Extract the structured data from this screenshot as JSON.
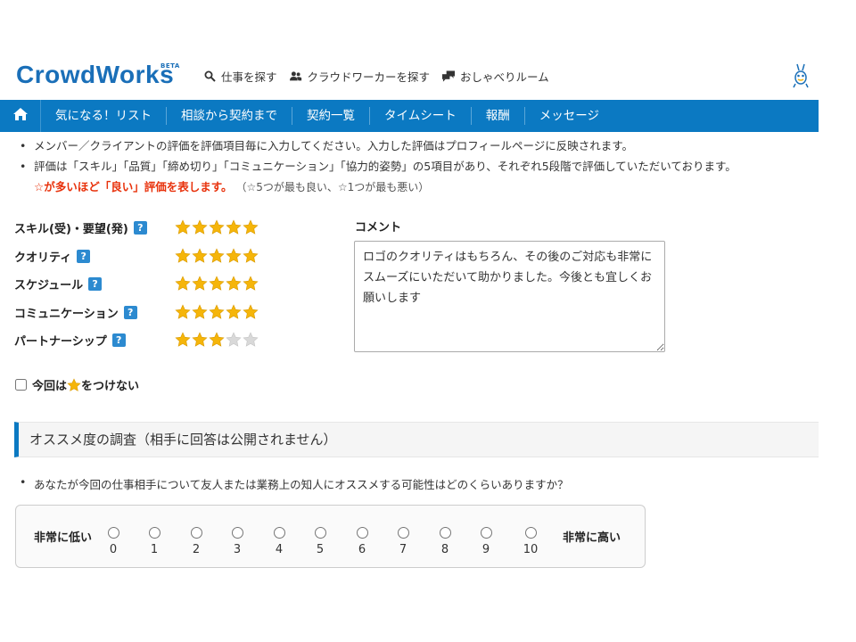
{
  "header": {
    "logo": "CrowdWorks",
    "logo_badge": "BETA",
    "links": [
      {
        "label": "仕事を探す",
        "icon": "search-icon"
      },
      {
        "label": "クラウドワーカーを探す",
        "icon": "users-icon"
      },
      {
        "label": "おしゃべりルーム",
        "icon": "chat-icon"
      }
    ]
  },
  "nav": {
    "home_icon": "home-icon",
    "items": [
      "気になる！リスト",
      "相談から契約まで",
      "契約一覧",
      "タイムシート",
      "報酬",
      "メッセージ"
    ]
  },
  "notes": {
    "line1": "メンバー／クライアントの評価を評価項目毎に入力してください。入力した評価はプロフィールページに反映されます。",
    "line2": "評価は「スキル」「品質」「締め切り」「コミュニケーション」「協力的姿勢」の5項目があり、それぞれ5段階で評価していただいております。",
    "line3_red": "☆が多いほど「良い」評価を表します。",
    "line3_gray": "（☆5つが最も良い、☆1つが最も悪い）"
  },
  "ratings": [
    {
      "label": "スキル(受)・要望(発)",
      "help": "?",
      "stars": 5
    },
    {
      "label": "クオリティ",
      "help": "?",
      "stars": 5
    },
    {
      "label": "スケジュール",
      "help": "?",
      "stars": 5
    },
    {
      "label": "コミュニケーション",
      "help": "?",
      "stars": 5
    },
    {
      "label": "パートナーシップ",
      "help": "?",
      "stars": 3
    }
  ],
  "max_stars": 5,
  "comment": {
    "label": "コメント",
    "value": "ロゴのクオリティはもちろん、その後のご対応も非常にスムーズにいただいて助かりました。今後とも宜しくお願いします"
  },
  "no_star": {
    "prefix": "今回は",
    "suffix": "をつけない",
    "checked": false
  },
  "survey": {
    "heading": "オススメ度の調査（相手に回答は公開されません）",
    "question": "あなたが今回の仕事相手について友人または業務上の知人にオススメする可能性はどのくらいありますか？",
    "low_label": "非常に低い",
    "high_label": "非常に高い",
    "options": [
      "0",
      "1",
      "2",
      "3",
      "4",
      "5",
      "6",
      "7",
      "8",
      "9",
      "10"
    ]
  },
  "colors": {
    "brand": "#1a6fb8",
    "nav_bg": "#0b79c2",
    "star_on": "#f5b50a",
    "star_off": "#d9d9d9",
    "emphasis": "#e8320c"
  }
}
